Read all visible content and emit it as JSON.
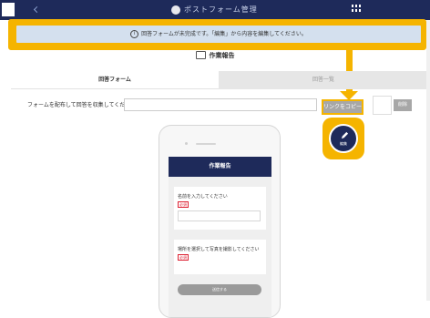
{
  "topbar": {
    "title": "ポストフォーム管理"
  },
  "banner": {
    "info_icon": "i",
    "message": "回答フォームが未完成です。「編集」から内容を編集してください。"
  },
  "page": {
    "title": "作業報告"
  },
  "tabs": [
    {
      "label": "回答フォーム",
      "active": true
    },
    {
      "label": "回答一覧",
      "active": false
    }
  ],
  "collect": {
    "label": "フォームを配布して回答を収集してください",
    "link_value": "",
    "copy_link_label": "リンクをコピー",
    "delete_label": "削除"
  },
  "edit_fab": {
    "label": "編集"
  },
  "preview": {
    "header": "作業報告",
    "questions": [
      {
        "text": "名前を入力してください",
        "required": "必須"
      },
      {
        "text": "場所を選択して写真を撮影してください",
        "required": "必須"
      }
    ],
    "submit_label": "送信する"
  },
  "colors": {
    "navy": "#1e2a5a",
    "highlight": "#f5b400",
    "banner_bg": "#d4e0ee"
  }
}
